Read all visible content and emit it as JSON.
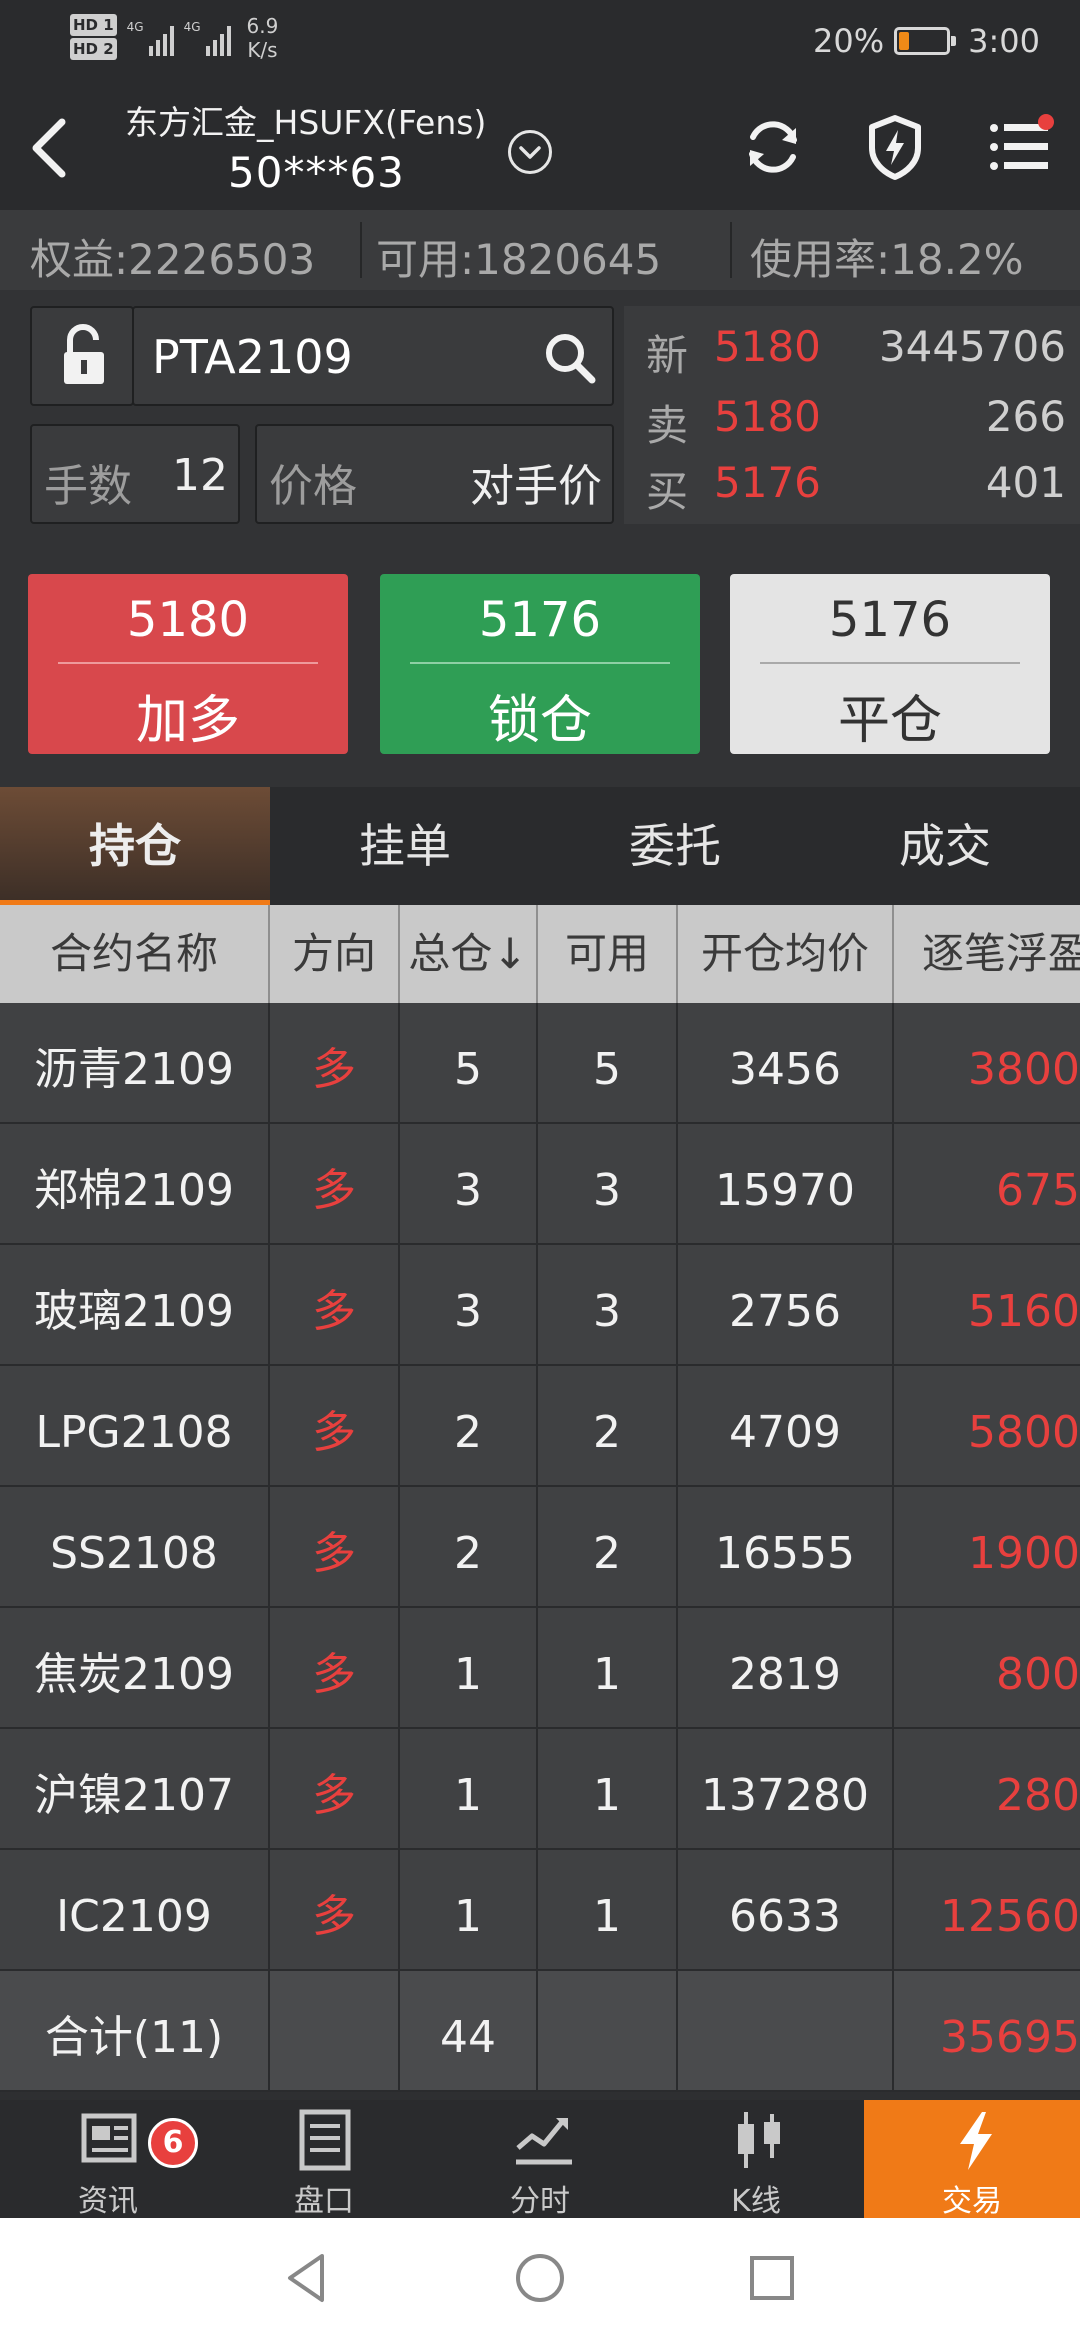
{
  "status": {
    "hd1": "HD 1",
    "hd2": "HD 2",
    "net1": "4G",
    "net2": "4G",
    "speed_value": "6.9",
    "speed_unit": "K/s",
    "battery_percent": "20%",
    "battery_level": 0.2,
    "time": "3:00"
  },
  "header": {
    "account_title": "东方汇金_HSUFX(Fens)",
    "account_id": "50***63"
  },
  "funds": {
    "equity": "权益:2226503",
    "available": "可用:1820645",
    "usage": "使用率:18.2%"
  },
  "order": {
    "symbol": "PTA2109",
    "qty_label": "手数",
    "qty_value": "12",
    "price_label": "价格",
    "price_value": "对手价"
  },
  "quote": {
    "rows": [
      {
        "label": "新",
        "price": "5180",
        "volume": "3445706"
      },
      {
        "label": "卖",
        "price": "5180",
        "volume": "266"
      },
      {
        "label": "买",
        "price": "5176",
        "volume": "401"
      }
    ]
  },
  "actions": {
    "long": {
      "price": "5180",
      "label": "加多"
    },
    "lock": {
      "price": "5176",
      "label": "锁仓"
    },
    "close": {
      "price": "5176",
      "label": "平仓"
    }
  },
  "tabs": [
    "持仓",
    "挂单",
    "委托",
    "成交"
  ],
  "table": {
    "headers": [
      "合约名称",
      "方向",
      "总仓↓",
      "可用",
      "开仓均价",
      "逐笔浮盈"
    ],
    "rows": [
      {
        "name": "沥青2109",
        "dir": "多",
        "total": "5",
        "avail": "5",
        "avg": "3456",
        "pl": "3800"
      },
      {
        "name": "郑棉2109",
        "dir": "多",
        "total": "3",
        "avail": "3",
        "avg": "15970",
        "pl": "675"
      },
      {
        "name": "玻璃2109",
        "dir": "多",
        "total": "3",
        "avail": "3",
        "avg": "2756",
        "pl": "5160"
      },
      {
        "name": "LPG2108",
        "dir": "多",
        "total": "2",
        "avail": "2",
        "avg": "4709",
        "pl": "5800"
      },
      {
        "name": "SS2108",
        "dir": "多",
        "total": "2",
        "avail": "2",
        "avg": "16555",
        "pl": "1900"
      },
      {
        "name": "焦炭2109",
        "dir": "多",
        "total": "1",
        "avail": "1",
        "avg": "2819",
        "pl": "800"
      },
      {
        "name": "沪镍2107",
        "dir": "多",
        "total": "1",
        "avail": "1",
        "avg": "137280",
        "pl": "280"
      },
      {
        "name": "IC2109",
        "dir": "多",
        "total": "1",
        "avail": "1",
        "avg": "6633",
        "pl": "12560"
      }
    ],
    "total": {
      "name": "合计(11)",
      "total": "44",
      "pl": "35695"
    }
  },
  "nav": {
    "items": [
      "资讯",
      "盘口",
      "分时",
      "K线",
      "交易"
    ],
    "badge": "6"
  },
  "colors": {
    "accent": "#f07a17",
    "up_red": "#e8403e",
    "long_btn": "#d8484c",
    "lock_btn": "#2f9e55"
  }
}
